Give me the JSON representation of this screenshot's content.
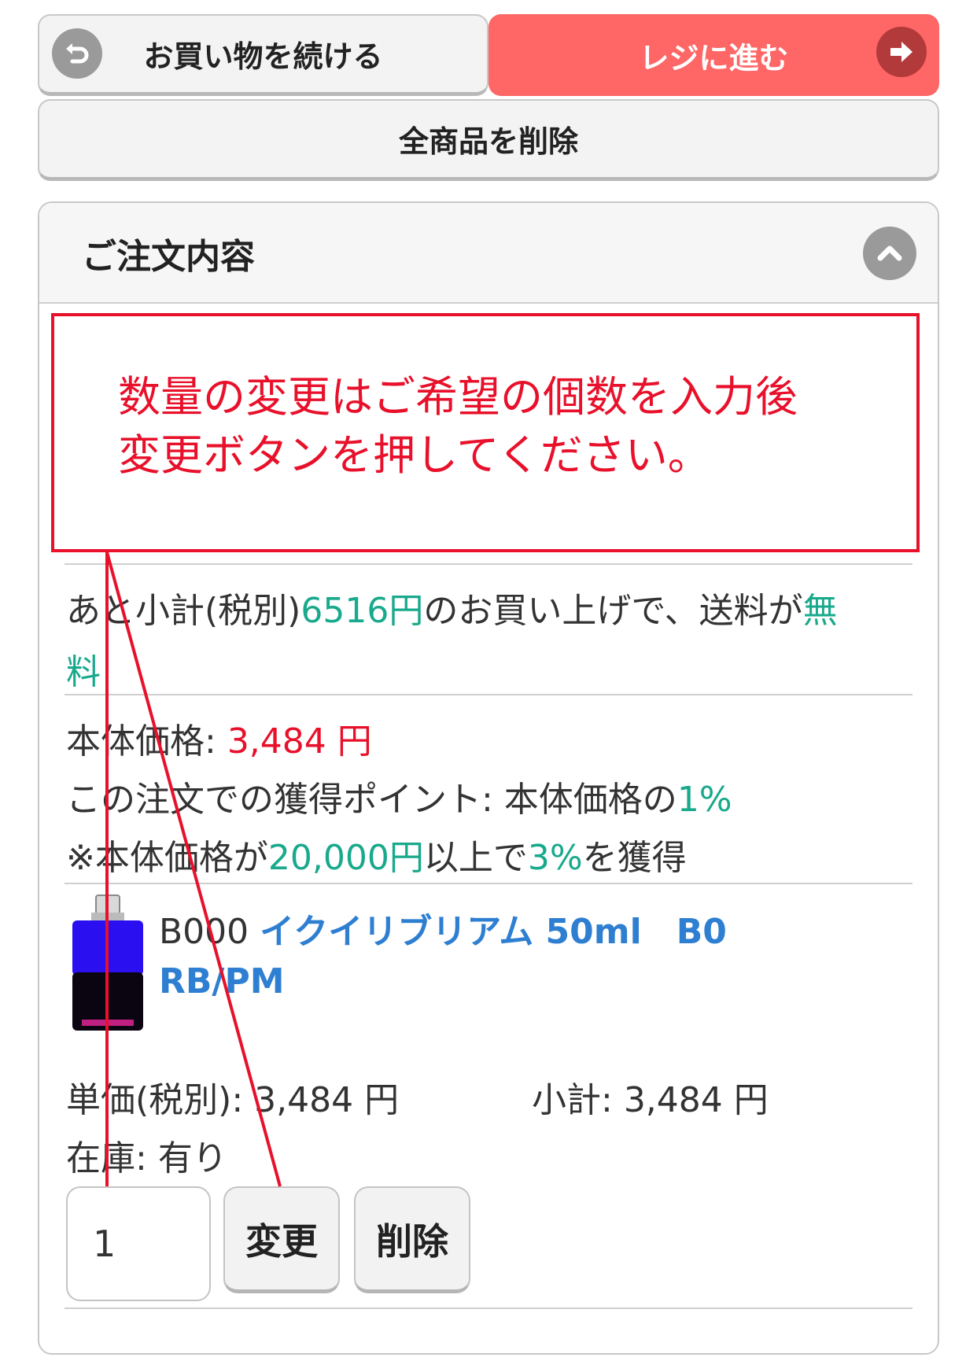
{
  "top_buttons": {
    "continue_label": "お買い物を続ける",
    "checkout_label": "レジに進む",
    "delete_all_label": "全商品を削除"
  },
  "order_panel": {
    "title": "ご注文内容"
  },
  "notice": {
    "text": "数量の変更はご希望の個数を入力後\n変更ボタンを押してください。"
  },
  "shipping_info": {
    "prefix": "あと小計(税別)",
    "amount": "6516円",
    "middle": "のお買い上げで、送料が",
    "free_part1": "無",
    "free_part2": "料"
  },
  "price_info": {
    "base_price_label": "本体価格: ",
    "base_price_value": "3,484 円",
    "points_label": "この注文での獲得ポイント: 本体価格の",
    "points_value": "1%",
    "bonus_prefix": "※本体価格が",
    "bonus_threshold": "20,000円",
    "bonus_mid": "以上で",
    "bonus_rate": "3%",
    "bonus_suffix": "を獲得"
  },
  "item": {
    "code": "B000",
    "name_line1": "イクイリブリアム 50ml　B0",
    "name_line2": "RB/PM",
    "unit_price_label": "単価(税別): ",
    "unit_price_value": "3,484 円",
    "subtotal_label": "小計: ",
    "subtotal_value": "3,484 円",
    "stock_label": "在庫: ",
    "stock_value": "有り",
    "quantity": "1",
    "change_label": "変更",
    "remove_label": "削除"
  },
  "colors": {
    "checkout_bg": "#ff6666",
    "accent_green": "#19a98c",
    "annotation_red": "#e8102a",
    "link_blue": "#2e7fd1"
  },
  "icons": [
    "back-arrow-icon",
    "forward-arrow-icon",
    "chevron-up-icon"
  ]
}
